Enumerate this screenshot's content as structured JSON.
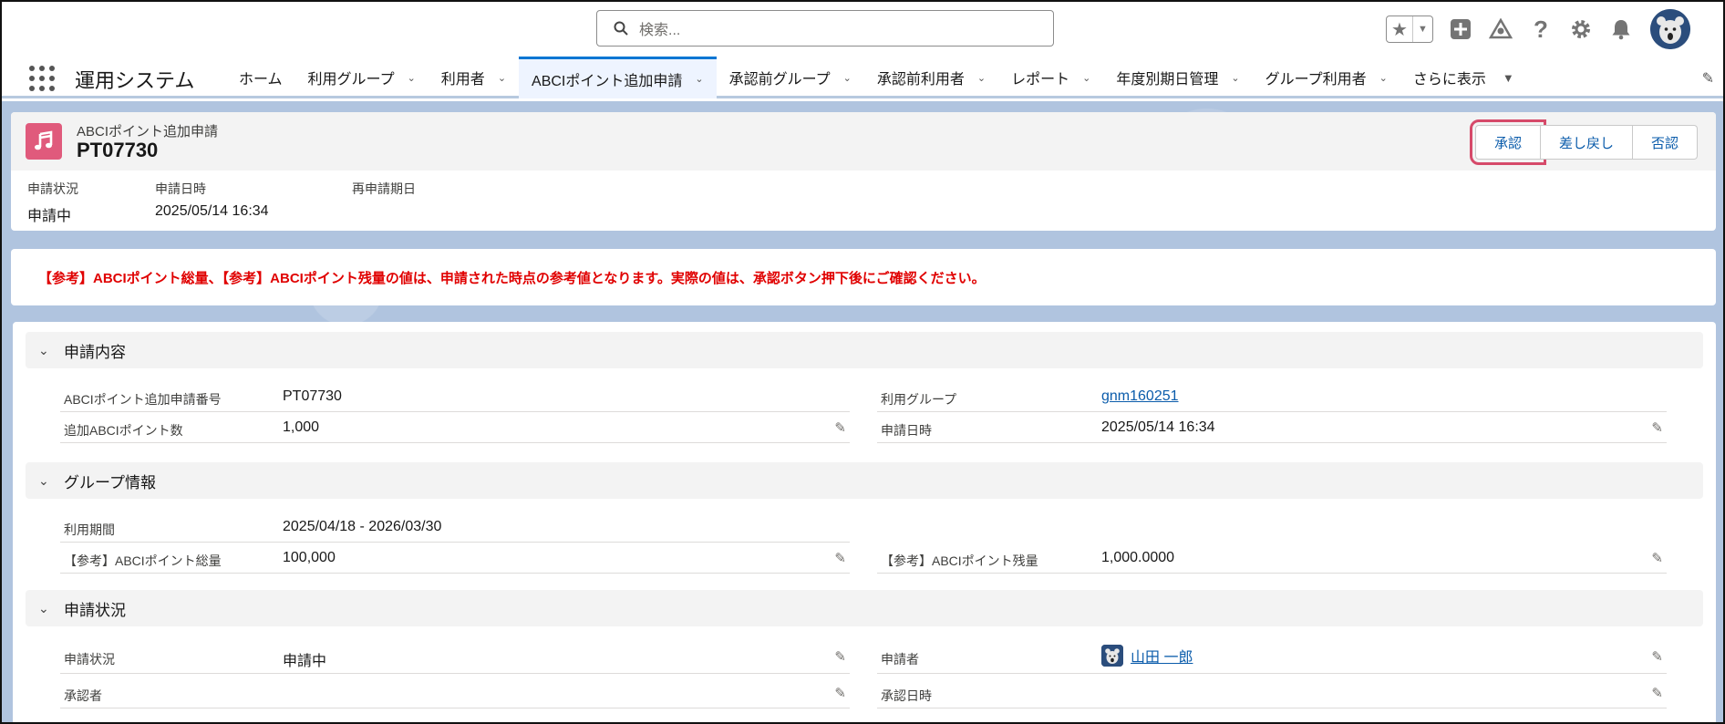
{
  "header": {
    "search_placeholder": "検索..."
  },
  "nav": {
    "app_name": "運用システム",
    "tabs": [
      {
        "label": "ホーム",
        "has_menu": false
      },
      {
        "label": "利用グループ",
        "has_menu": true
      },
      {
        "label": "利用者",
        "has_menu": true
      },
      {
        "label": "ABCIポイント追加申請",
        "has_menu": true,
        "active": true
      },
      {
        "label": "承認前グループ",
        "has_menu": true
      },
      {
        "label": "承認前利用者",
        "has_menu": true
      },
      {
        "label": "レポート",
        "has_menu": true
      },
      {
        "label": "年度別期日管理",
        "has_menu": true
      },
      {
        "label": "グループ利用者",
        "has_menu": true
      }
    ],
    "more_label": "さらに表示"
  },
  "record": {
    "object_type": "ABCIポイント追加申請",
    "name": "PT07730",
    "icon": "music-note-icon",
    "actions": {
      "approve": "承認",
      "send_back": "差し戻し",
      "reject": "否認"
    },
    "highlights": [
      {
        "label": "申請状況",
        "value": "申請中"
      },
      {
        "label": "申請日時",
        "value": "2025/05/14 16:34"
      },
      {
        "label": "再申請期日",
        "value": ""
      }
    ]
  },
  "notice": "【参考】ABCIポイント総量、【参考】ABCIポイント残量の値は、申請された時点の参考値となります。実際の値は、承認ボタン押下後にご確認ください。",
  "sections": {
    "request": {
      "title": "申請内容",
      "fields": {
        "request_number": {
          "label": "ABCIポイント追加申請番号",
          "value": "PT07730"
        },
        "group": {
          "label": "利用グループ",
          "value": "gnm160251"
        },
        "points": {
          "label": "追加ABCIポイント数",
          "value": "1,000"
        },
        "date": {
          "label": "申請日時",
          "value": "2025/05/14 16:34"
        }
      }
    },
    "group": {
      "title": "グループ情報",
      "fields": {
        "period": {
          "label": "利用期間",
          "value": "2025/04/18 - 2026/03/30"
        },
        "total": {
          "label": "【参考】ABCIポイント総量",
          "value": "100,000"
        },
        "remaining": {
          "label": "【参考】ABCIポイント残量",
          "value": "1,000.0000"
        }
      }
    },
    "status": {
      "title": "申請状況",
      "fields": {
        "status": {
          "label": "申請状況",
          "value": "申請中"
        },
        "applicant": {
          "label": "申請者",
          "value": "山田 一郎"
        },
        "approver": {
          "label": "承認者",
          "value": ""
        },
        "approved_at": {
          "label": "承認日時",
          "value": ""
        }
      }
    }
  },
  "colors": {
    "brand_blue": "#0176d3",
    "link": "#0b5cab",
    "notice_red": "#e00000",
    "object_icon": "#e05a7c",
    "highlight_box": "#d64a6a"
  }
}
